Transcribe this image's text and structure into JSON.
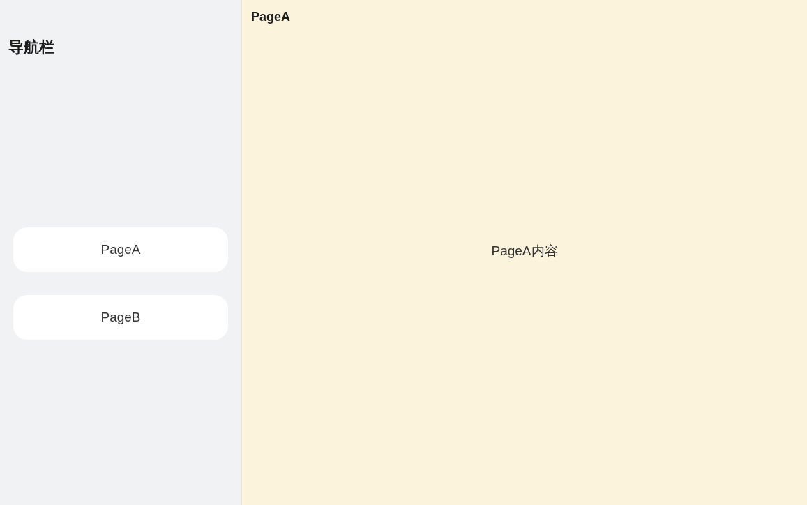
{
  "sidebar": {
    "title": "导航栏",
    "items": [
      {
        "label": "PageA"
      },
      {
        "label": "PageB"
      }
    ]
  },
  "page": {
    "title": "PageA",
    "content": "PageA内容"
  }
}
